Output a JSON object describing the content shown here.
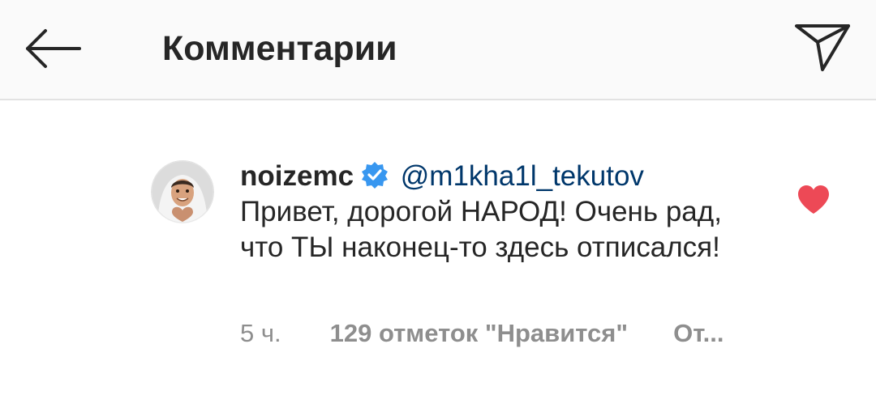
{
  "header": {
    "title": "Комментарии",
    "back_icon": "arrow-left-icon",
    "send_icon": "paper-plane-icon"
  },
  "comment": {
    "username": "noizemc",
    "verified": true,
    "mention": "@m1kha1l_tekutov",
    "text": "Привет, дорогой НАРОД! Очень рад, что ТЫ наконец-то здесь отписался!",
    "time": "5 ч.",
    "likes": "129 отметок \"Нравится\"",
    "reply": "От...",
    "liked": true
  },
  "colors": {
    "header_bg": "#fafafa",
    "text": "#262626",
    "secondary": "#8e8e8e",
    "mention": "#00376b",
    "verified": "#3897f0",
    "like": "#ed4956"
  }
}
